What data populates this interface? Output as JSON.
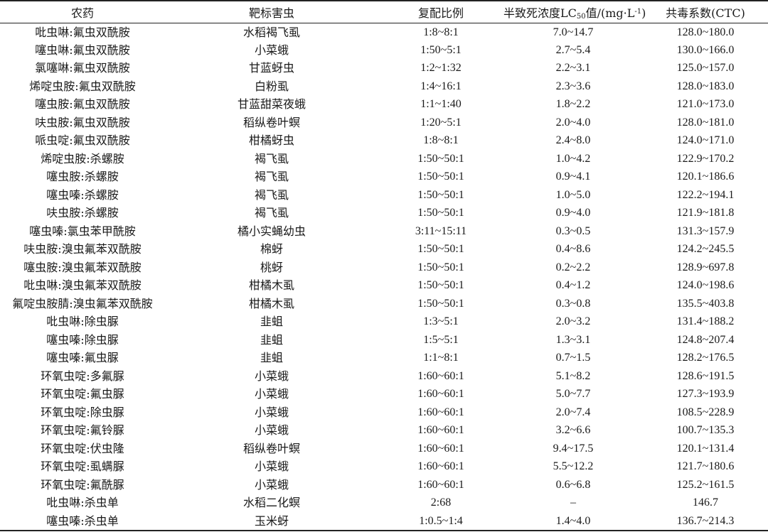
{
  "table": {
    "headers": {
      "pesticide": "农药",
      "target": "靶标害虫",
      "ratio": "复配比例",
      "lc50_prefix": "半致死浓度LC",
      "lc50_sub": "50",
      "lc50_mid": "值/(mg·L",
      "lc50_sup": "-1",
      "lc50_suffix": ")",
      "ctc": "共毒系数(CTC)"
    },
    "rows": [
      {
        "pesticide": "吡虫啉:氟虫双酰胺",
        "target": "水稻褐飞虱",
        "ratio": "1:8~8:1",
        "lc50": "7.0~14.7",
        "ctc": "128.0~180.0"
      },
      {
        "pesticide": "噻虫啉:氟虫双酰胺",
        "target": "小菜蛾",
        "ratio": "1:50~5:1",
        "lc50": "2.7~5.4",
        "ctc": "130.0~166.0"
      },
      {
        "pesticide": "氯噻啉:氟虫双酰胺",
        "target": "甘蓝蚜虫",
        "ratio": "1:2~1:32",
        "lc50": "2.2~3.1",
        "ctc": "125.0~157.0"
      },
      {
        "pesticide": "烯啶虫胺:氟虫双酰胺",
        "target": "白粉虱",
        "ratio": "1:4~16:1",
        "lc50": "2.3~3.6",
        "ctc": "128.0~183.0"
      },
      {
        "pesticide": "噻虫胺:氟虫双酰胺",
        "target": "甘蓝甜菜夜蛾",
        "ratio": "1:1~1:40",
        "lc50": "1.8~2.2",
        "ctc": "121.0~173.0"
      },
      {
        "pesticide": "呋虫胺:氟虫双酰胺",
        "target": "稻纵卷叶螟",
        "ratio": "1:20~5:1",
        "lc50": "2.0~4.0",
        "ctc": "128.0~181.0"
      },
      {
        "pesticide": "哌虫啶:氟虫双酰胺",
        "target": "柑橘蚜虫",
        "ratio": "1:8~8:1",
        "lc50": "2.4~8.0",
        "ctc": "124.0~171.0"
      },
      {
        "pesticide": "烯啶虫胺:杀螺胺",
        "target": "褐飞虱",
        "ratio": "1:50~50:1",
        "lc50": "1.0~4.2",
        "ctc": "122.9~170.2"
      },
      {
        "pesticide": "噻虫胺:杀螺胺",
        "target": "褐飞虱",
        "ratio": "1:50~50:1",
        "lc50": "0.9~4.1",
        "ctc": "120.1~186.6"
      },
      {
        "pesticide": "噻虫嗪:杀螺胺",
        "target": "褐飞虱",
        "ratio": "1:50~50:1",
        "lc50": "1.0~5.0",
        "ctc": "122.2~194.1"
      },
      {
        "pesticide": "呋虫胺:杀螺胺",
        "target": "褐飞虱",
        "ratio": "1:50~50:1",
        "lc50": "0.9~4.0",
        "ctc": "121.9~181.8"
      },
      {
        "pesticide": "噻虫嗪:氯虫苯甲酰胺",
        "target": "橘小实蝇幼虫",
        "ratio": "3:11~15:11",
        "lc50": "0.3~0.5",
        "ctc": "131.3~157.9"
      },
      {
        "pesticide": "呋虫胺:溴虫氟苯双酰胺",
        "target": "棉蚜",
        "ratio": "1:50~50:1",
        "lc50": "0.4~8.6",
        "ctc": "124.2~245.5"
      },
      {
        "pesticide": "噻虫胺:溴虫氟苯双酰胺",
        "target": "桃蚜",
        "ratio": "1:50~50:1",
        "lc50": "0.2~2.2",
        "ctc": "128.9~697.8"
      },
      {
        "pesticide": "吡虫啉:溴虫氟苯双酰胺",
        "target": "柑橘木虱",
        "ratio": "1:50~50:1",
        "lc50": "0.4~1.2",
        "ctc": "124.0~198.6"
      },
      {
        "pesticide": "氟啶虫胺腈:溴虫氟苯双酰胺",
        "target": "柑橘木虱",
        "ratio": "1:50~50:1",
        "lc50": "0.3~0.8",
        "ctc": "135.5~403.8"
      },
      {
        "pesticide": "吡虫啉:除虫脲",
        "target": "韭蛆",
        "ratio": "1:3~5:1",
        "lc50": "2.0~3.2",
        "ctc": "131.4~188.2"
      },
      {
        "pesticide": "噻虫嗪:除虫脲",
        "target": "韭蛆",
        "ratio": "1:5~5:1",
        "lc50": "1.3~3.1",
        "ctc": "124.8~207.4"
      },
      {
        "pesticide": "噻虫嗪:氟虫脲",
        "target": "韭蛆",
        "ratio": "1:1~8:1",
        "lc50": "0.7~1.5",
        "ctc": "128.2~176.5"
      },
      {
        "pesticide": "环氧虫啶:多氟脲",
        "target": "小菜蛾",
        "ratio": "1:60~60:1",
        "lc50": "5.1~8.2",
        "ctc": "128.6~191.5"
      },
      {
        "pesticide": "环氧虫啶:氟虫脲",
        "target": "小菜蛾",
        "ratio": "1:60~60:1",
        "lc50": "5.0~7.7",
        "ctc": "127.3~193.9"
      },
      {
        "pesticide": "环氧虫啶:除虫脲",
        "target": "小菜蛾",
        "ratio": "1:60~60:1",
        "lc50": "2.0~7.4",
        "ctc": "108.5~228.9"
      },
      {
        "pesticide": "环氧虫啶:氟铃脲",
        "target": "小菜蛾",
        "ratio": "1:60~60:1",
        "lc50": "3.2~6.6",
        "ctc": "100.7~135.3"
      },
      {
        "pesticide": "环氧虫啶:伏虫隆",
        "target": "稻纵卷叶螟",
        "ratio": "1:60~60:1",
        "lc50": "9.4~17.5",
        "ctc": "120.1~131.4"
      },
      {
        "pesticide": "环氧虫啶:虱螨脲",
        "target": "小菜蛾",
        "ratio": "1:60~60:1",
        "lc50": "5.5~12.2",
        "ctc": "121.7~180.6"
      },
      {
        "pesticide": "环氧虫啶:氟酰脲",
        "target": "小菜蛾",
        "ratio": "1:60~60:1",
        "lc50": "0.6~6.8",
        "ctc": "125.2~161.5"
      },
      {
        "pesticide": "吡虫啉:杀虫单",
        "target": "水稻二化螟",
        "ratio": "2:68",
        "lc50": "–",
        "ctc": "146.7"
      },
      {
        "pesticide": "噻虫嗪:杀虫单",
        "target": "玉米蚜",
        "ratio": "1:0.5~1:4",
        "lc50": "1.4~4.0",
        "ctc": "136.7~214.3"
      }
    ]
  }
}
